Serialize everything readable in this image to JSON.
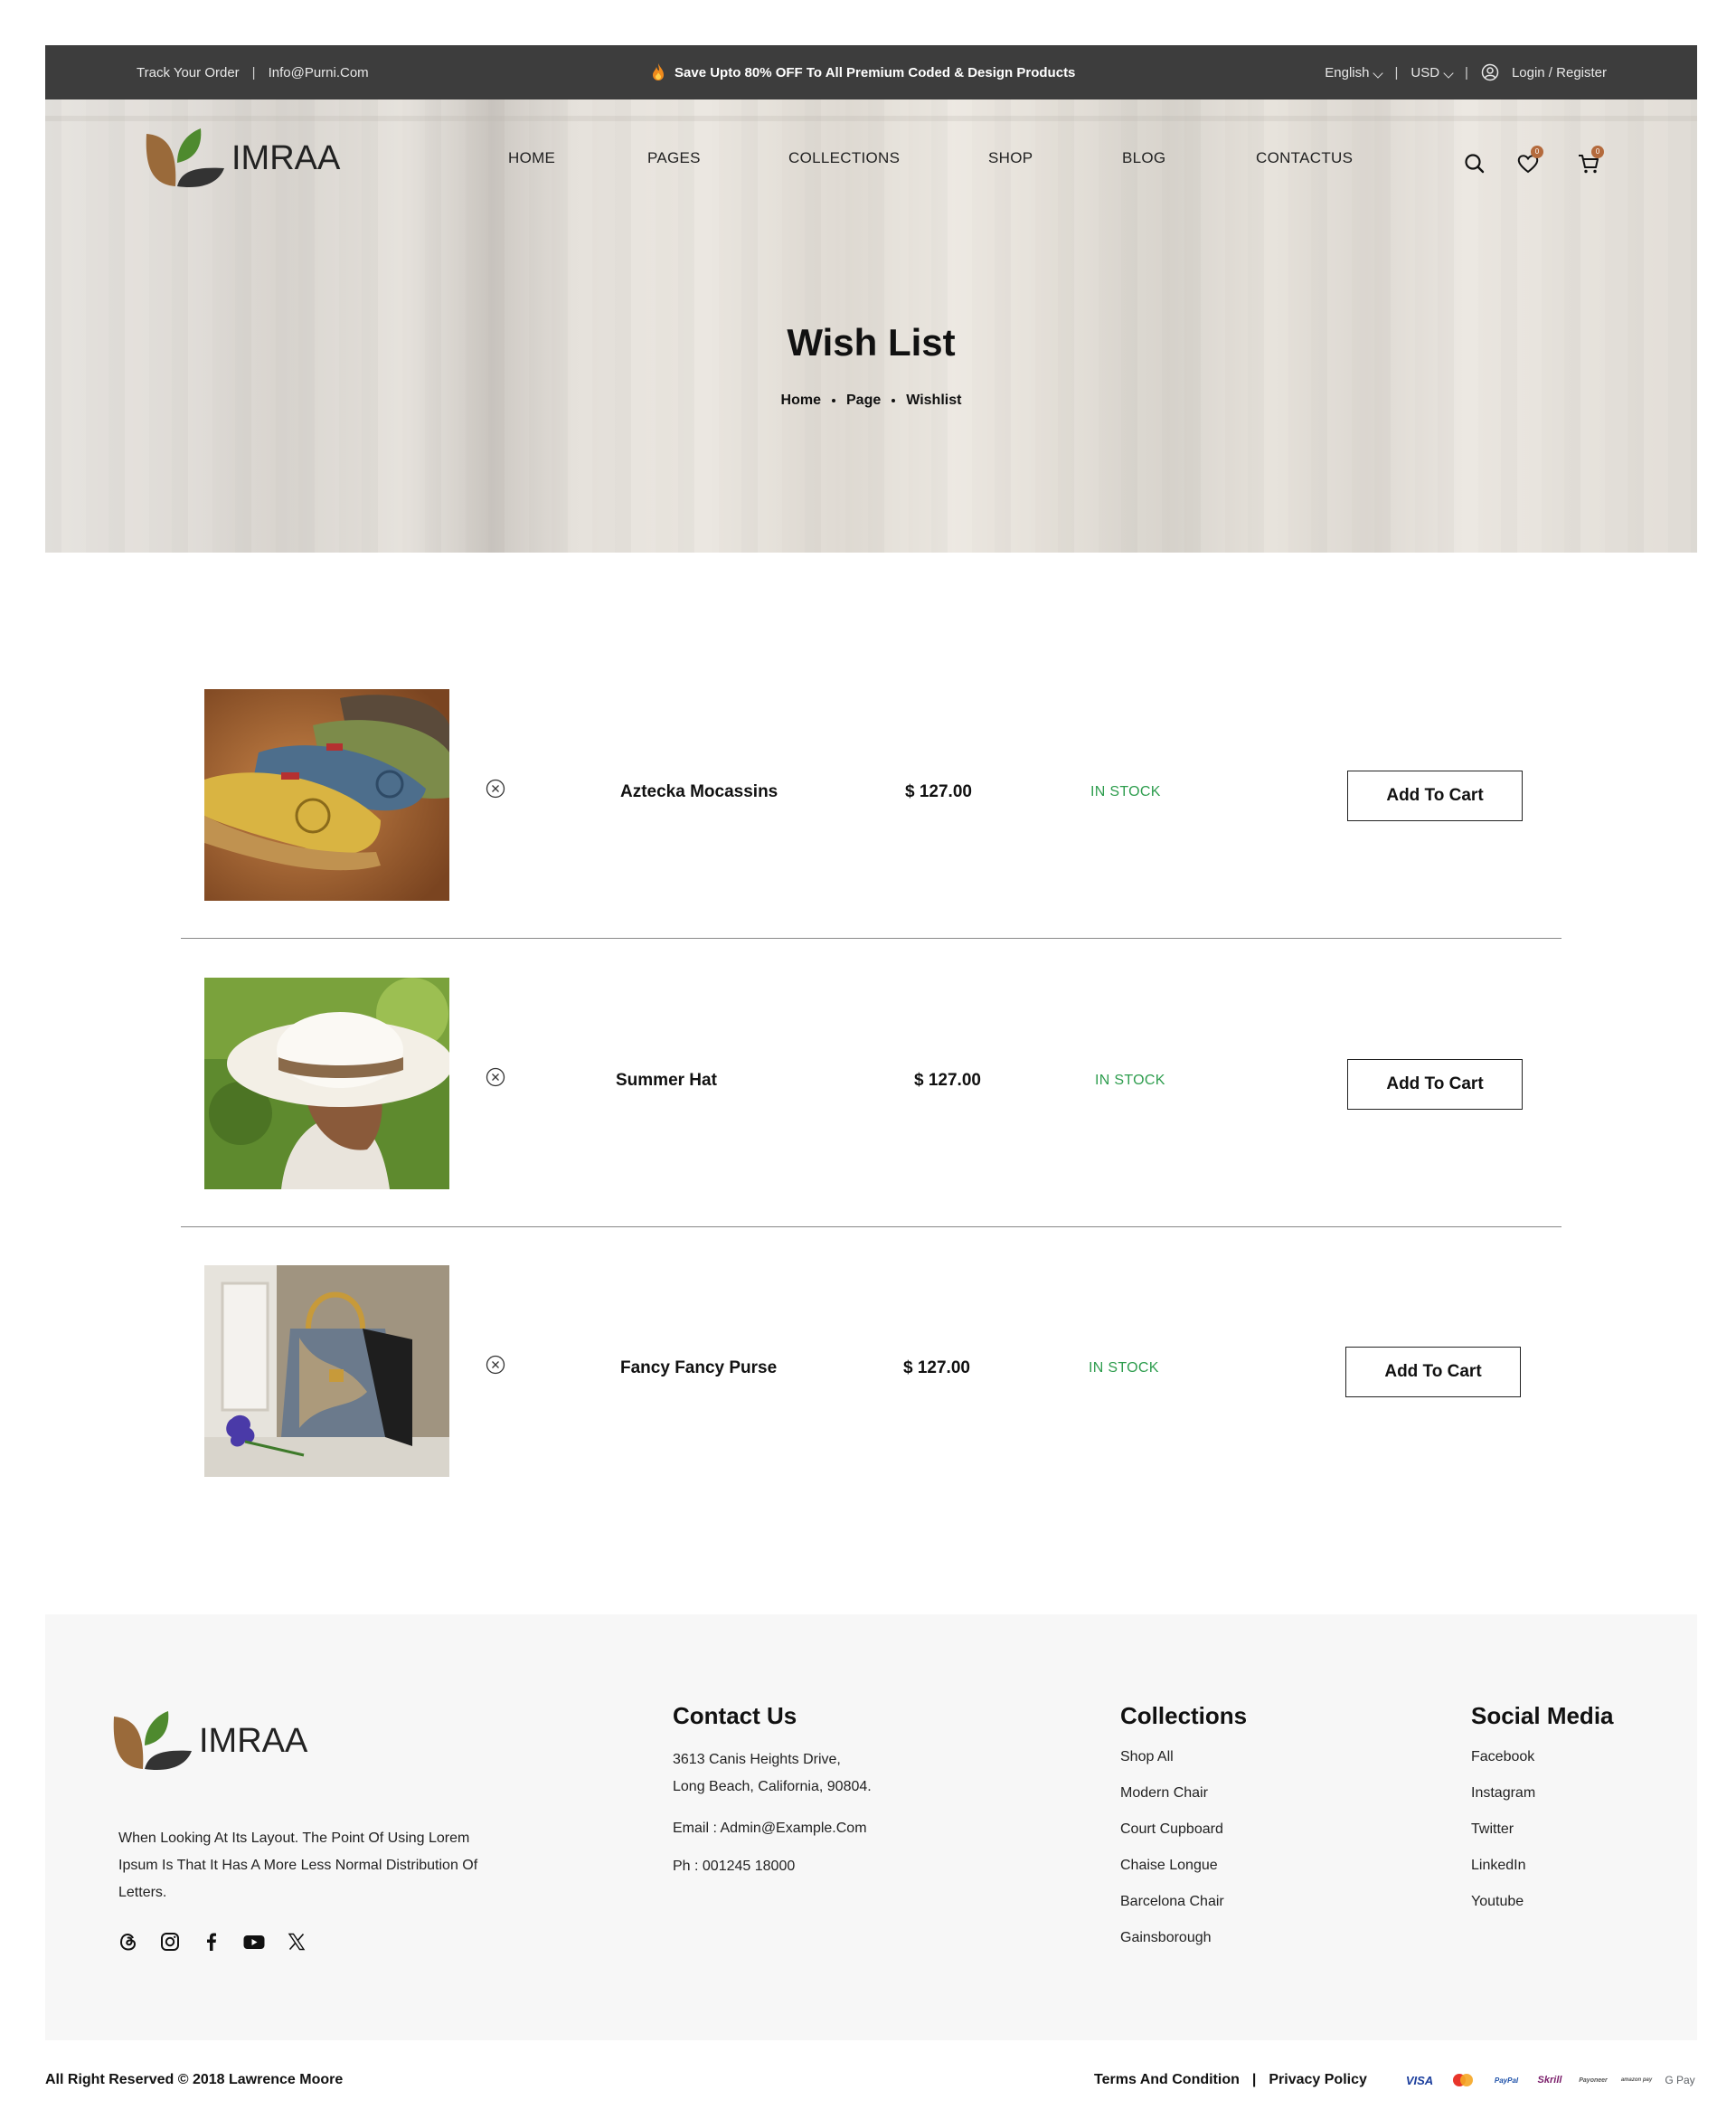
{
  "topbar": {
    "track_order": "Track Your Order",
    "email": "Info@Purni.Com",
    "promo": "Save Upto 80% OFF To All Premium Coded & Design Products",
    "language": "English",
    "currency": "USD",
    "login": "Login / Register"
  },
  "header": {
    "logo_text": "IMRAA",
    "nav": [
      "HOME",
      "PAGES",
      "COLLECTIONS",
      "SHOP",
      "BLOG",
      "CONTACTUS"
    ],
    "wishlist_count": "0",
    "cart_count": "0"
  },
  "hero": {
    "title": "Wish List",
    "breadcrumb": [
      "Home",
      "Page",
      "Wishlist"
    ]
  },
  "wishlist": [
    {
      "name": "Aztecka Mocassins",
      "price": "$ 127.00",
      "stock": "IN STOCK",
      "button": "Add To Cart",
      "image": "shoes-photo"
    },
    {
      "name": "Summer Hat",
      "price": "$ 127.00",
      "stock": "IN STOCK",
      "button": "Add To Cart",
      "image": "hat-photo"
    },
    {
      "name": "Fancy Fancy Purse",
      "price": "$ 127.00",
      "stock": "IN STOCK",
      "button": "Add To Cart",
      "image": "purse-photo"
    }
  ],
  "footer": {
    "logo_text": "IMRAA",
    "about": "When Looking At Its Layout. The Point Of Using Lorem Ipsum Is That It Has A More Less Normal Distribution Of Letters.",
    "social_icons": [
      "threads-icon",
      "instagram-icon",
      "facebook-icon",
      "youtube-icon",
      "x-icon"
    ],
    "contact": {
      "title": "Contact Us",
      "address_1": "3613 Canis Heights Drive,",
      "address_2": "Long Beach, California, 90804.",
      "email": "Email : Admin@Example.Com",
      "phone": "Ph : 001245 18000"
    },
    "collections": {
      "title": "Collections",
      "items": [
        "Shop All",
        "Modern Chair",
        "Court Cupboard",
        "Chaise Longue",
        "Barcelona Chair",
        "Gainsborough"
      ]
    },
    "social": {
      "title": "Social Media",
      "items": [
        "Facebook",
        "Instagram",
        "Twitter",
        "LinkedIn",
        "Youtube"
      ]
    }
  },
  "bottom": {
    "copyright": "All Right Reserved © 2018 Lawrence Moore",
    "terms": "Terms And Condition",
    "separator": "|",
    "privacy": "Privacy Policy",
    "payments": [
      "VISA",
      "",
      "PayPal",
      "Skrill",
      "Payoneer",
      "amazon pay",
      "G Pay"
    ]
  },
  "colors": {
    "topbar_bg": "#3d3d3d",
    "in_stock": "#2e9d4e",
    "logo_brown": "#9a6a3a",
    "logo_green": "#4e8a2e",
    "logo_dark": "#333333",
    "badge": "#b46a3c",
    "footer_bg": "#f7f7f7"
  }
}
